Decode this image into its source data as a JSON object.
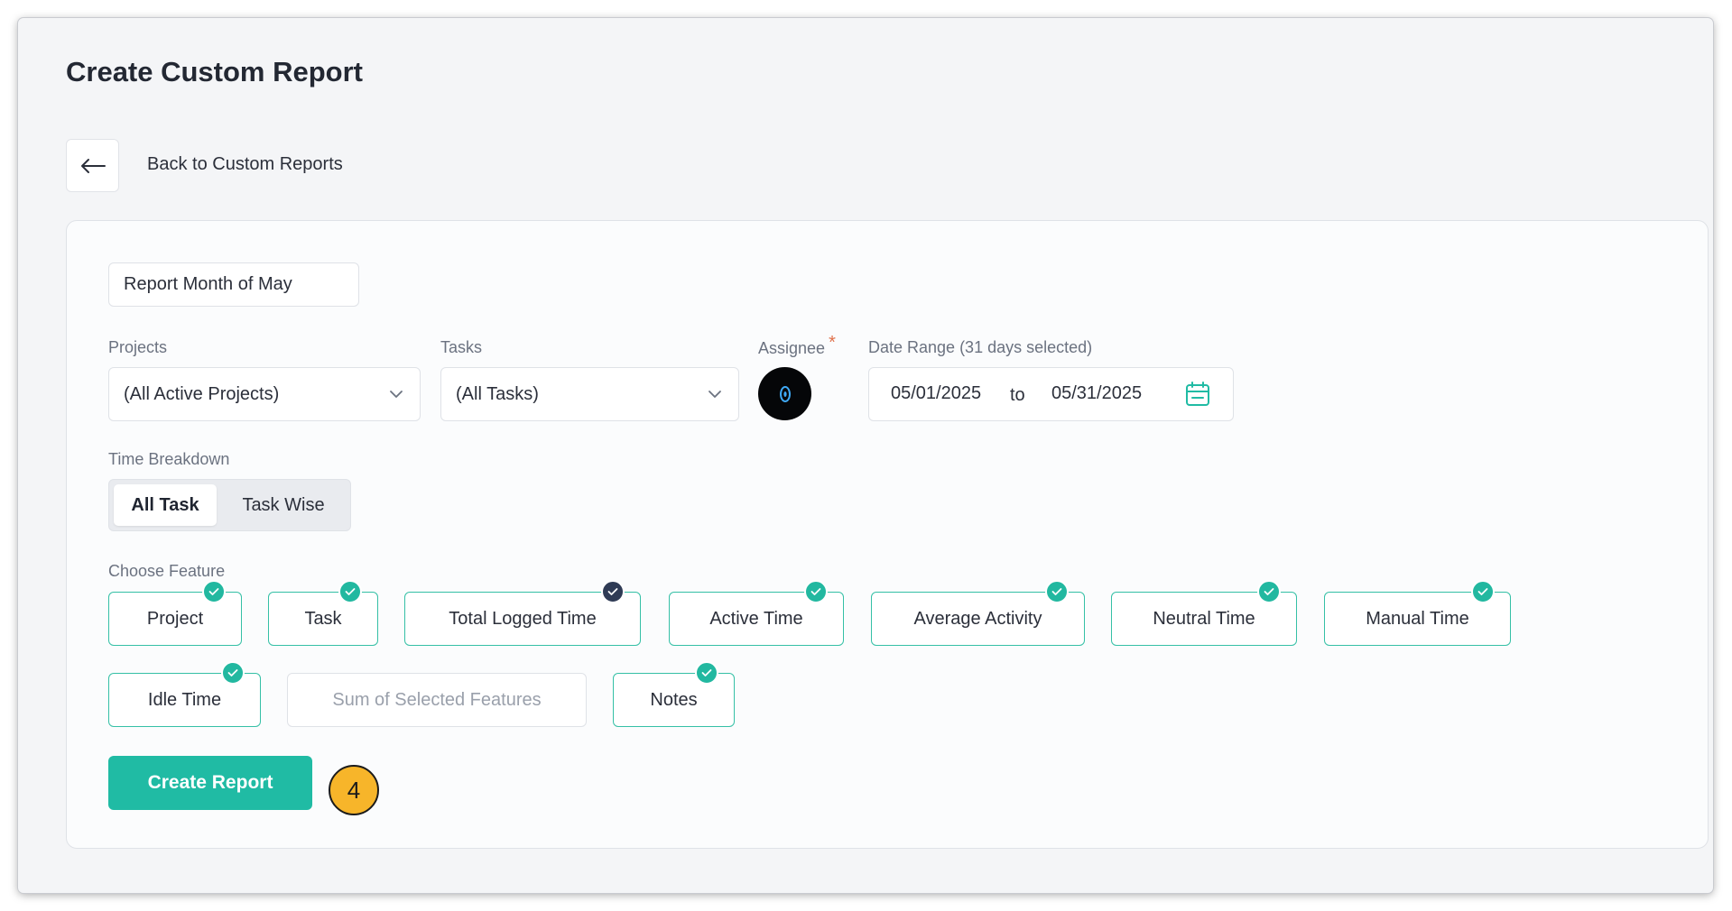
{
  "page": {
    "title": "Create Custom Report",
    "back_label": "Back to Custom Reports"
  },
  "form": {
    "report_name": "Report Month of May",
    "projects": {
      "label": "Projects",
      "value": "(All Active Projects)"
    },
    "tasks": {
      "label": "Tasks",
      "value": "(All Tasks)"
    },
    "assignee": {
      "label": "Assignee",
      "required_mark": "*"
    },
    "date_range": {
      "label": "Date Range (31 days selected)",
      "start": "05/01/2025",
      "separator": "to",
      "end": "05/31/2025"
    },
    "time_breakdown": {
      "label": "Time Breakdown",
      "options": [
        "All Task",
        "Task Wise"
      ],
      "selected": "All Task"
    },
    "features": {
      "label": "Choose Feature",
      "items": [
        {
          "label": "Project",
          "checked": true
        },
        {
          "label": "Task",
          "checked": true
        },
        {
          "label": "Total Logged Time",
          "checked": true,
          "locked": true
        },
        {
          "label": "Active Time",
          "checked": true
        },
        {
          "label": "Average Activity",
          "checked": true
        },
        {
          "label": "Neutral Time",
          "checked": true
        },
        {
          "label": "Manual Time",
          "checked": true
        },
        {
          "label": "Idle Time",
          "checked": true
        },
        {
          "label": "Sum of Selected Features",
          "checked": false,
          "disabled": true
        },
        {
          "label": "Notes",
          "checked": true
        }
      ]
    },
    "submit_label": "Create Report"
  },
  "annotation": {
    "step": "4"
  },
  "colors": {
    "accent": "#20bba4",
    "check": "#22b8a0",
    "check_locked": "#2f3b55",
    "required": "#e0714c",
    "step_badge": "#f7b52a"
  },
  "icons": {
    "back": "arrow-left-icon",
    "dropdown": "chevron-down-icon",
    "calendar": "calendar-icon",
    "check": "check-icon",
    "avatar": "avatar-icon"
  }
}
